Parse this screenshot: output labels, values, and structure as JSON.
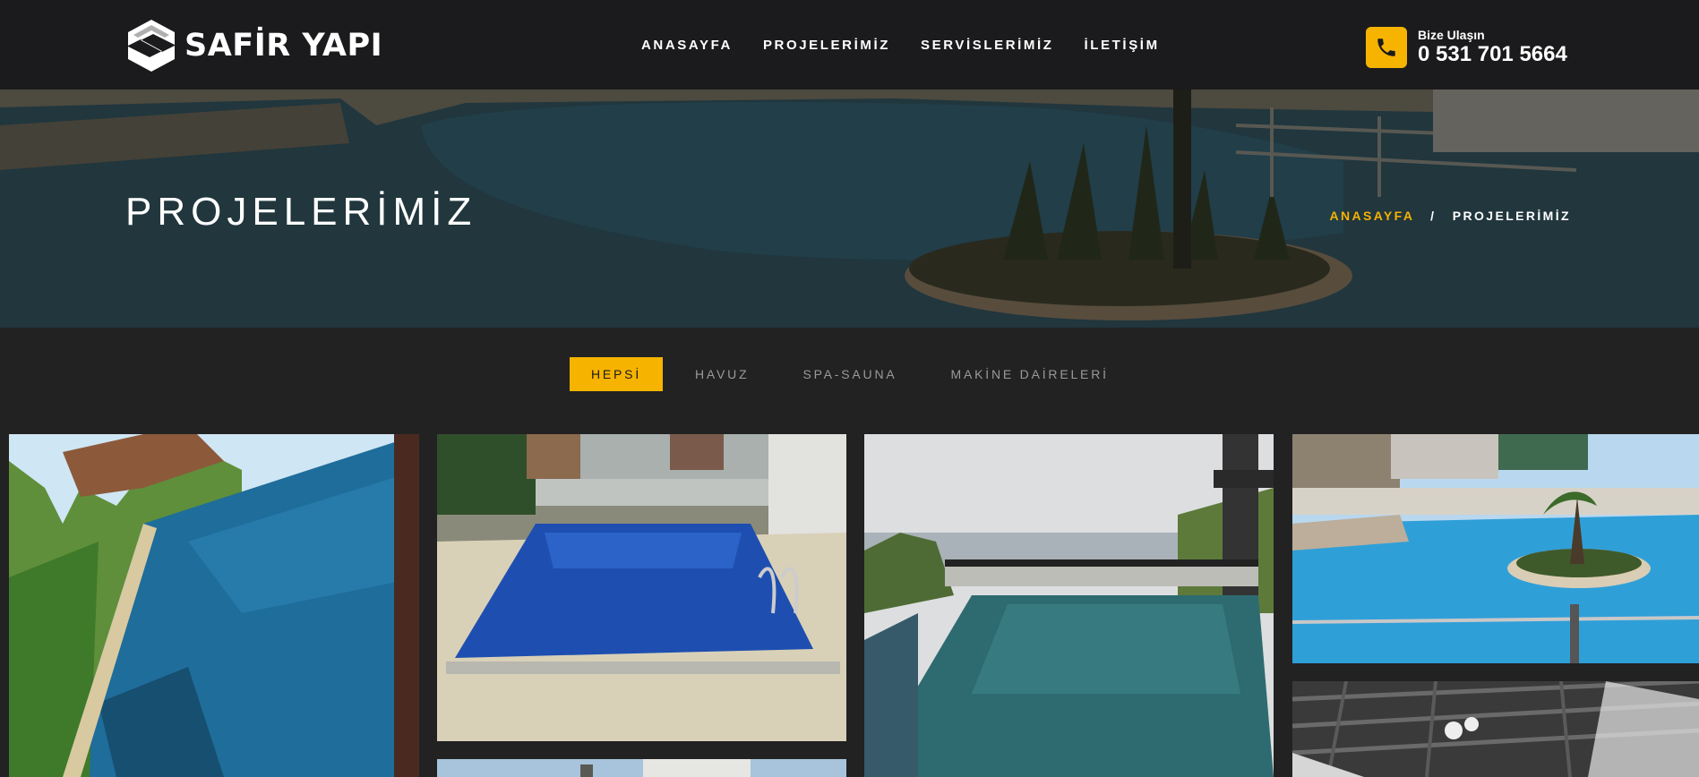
{
  "brand": {
    "name": "SAFİR YAPI"
  },
  "nav": {
    "items": [
      {
        "label": "ANASAYFA"
      },
      {
        "label": "PROJELERİMİZ"
      },
      {
        "label": "SERVİSLERİMİZ"
      },
      {
        "label": "İLETİŞİM"
      }
    ]
  },
  "contact": {
    "label": "Bize Ulaşın",
    "phone": "0 531 701 5664",
    "icon": "phone-icon"
  },
  "hero": {
    "title": "PROJELERİMİZ",
    "breadcrumb": {
      "home": "ANASAYFA",
      "separator": "/",
      "current": "PROJELERİMİZ"
    }
  },
  "filters": {
    "items": [
      {
        "label": "HEPSİ",
        "active": true
      },
      {
        "label": "HAVUZ",
        "active": false
      },
      {
        "label": "SPA-SAUNA",
        "active": false
      },
      {
        "label": "MAKİNE DAİRELERİ",
        "active": false
      }
    ]
  },
  "colors": {
    "accent": "#f6b300",
    "header_bg": "#1b1b1d",
    "page_bg": "#222222"
  }
}
